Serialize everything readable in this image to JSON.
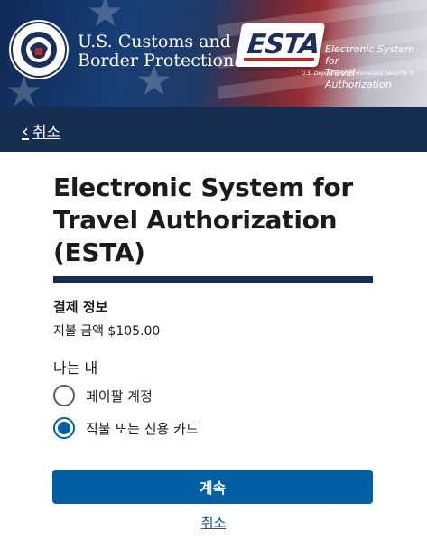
{
  "header": {
    "agency_line1": "U.S. Customs and",
    "agency_line2": "Border Protection",
    "seal_text_top": "U.S. DEPARTMENT OF",
    "seal_text_bottom": "HOMELAND SECURITY",
    "esta_logo_text": "ESTA",
    "esta_title_line1": "Electronic System for",
    "esta_title_line2": "Travel Authorization",
    "esta_sub": "U.S. Department of Homeland Security ®"
  },
  "nav": {
    "back_label": "취소"
  },
  "main": {
    "title": "Electronic System for Travel Authorization (ESTA)",
    "payment_info_label": "결제 정보",
    "amount_label": "지불 금액 $105.00",
    "method_label": "나는 내",
    "options": [
      {
        "label": "페이팔 계정",
        "checked": false
      },
      {
        "label": "직불 또는 신용 카드",
        "checked": true
      }
    ],
    "continue_label": "계속",
    "cancel_label": "취소"
  },
  "colors": {
    "navy": "#162e51",
    "primary_blue": "#005ea2",
    "text": "#1b1b1b"
  }
}
